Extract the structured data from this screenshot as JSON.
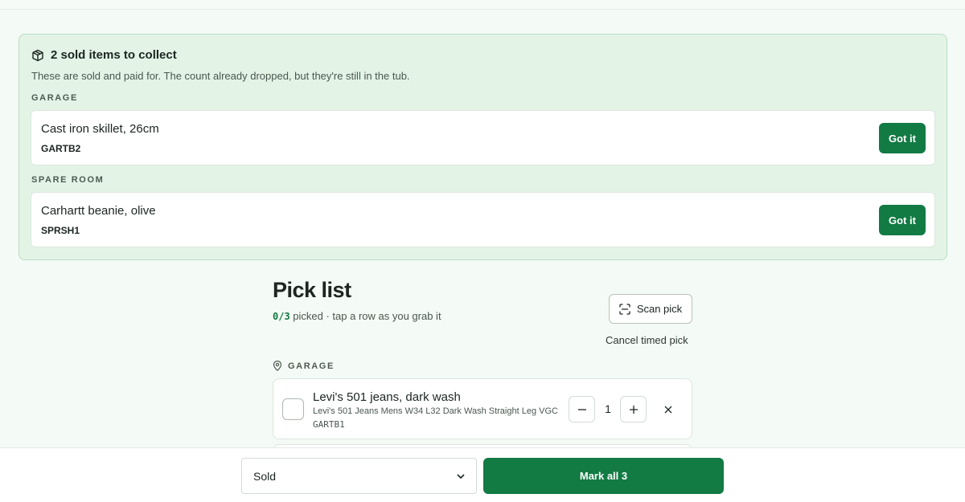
{
  "banner": {
    "title": "2 sold items to collect",
    "description": "These are sold and paid for. The count already dropped, but they're still in the tub.",
    "groups": [
      {
        "location": "GARAGE",
        "item": {
          "name": "Cast iron skillet, 26cm",
          "sku": "GARTB2",
          "action": "Got it"
        }
      },
      {
        "location": "SPARE ROOM",
        "item": {
          "name": "Carhartt beanie, olive",
          "sku": "SPRSH1",
          "action": "Got it"
        }
      }
    ]
  },
  "pick": {
    "title": "Pick list",
    "count": "0/3",
    "subtitle_rest": " picked · tap a row as you grab it",
    "scan_label": "Scan pick",
    "cancel_label": "Cancel timed pick",
    "location": "GARAGE",
    "items": [
      {
        "name": "Levi's 501 jeans, dark wash",
        "description": "Levi's 501 Jeans Mens W34 L32 Dark Wash Straight Leg VGC",
        "sku": "GARTB1",
        "qty": "1"
      }
    ]
  },
  "footer": {
    "status_value": "Sold",
    "mark_label": "Mark all 3"
  },
  "colors": {
    "accent": "#127a43",
    "banner_bg": "#e3f4e7",
    "page_bg": "#f4faf5"
  }
}
